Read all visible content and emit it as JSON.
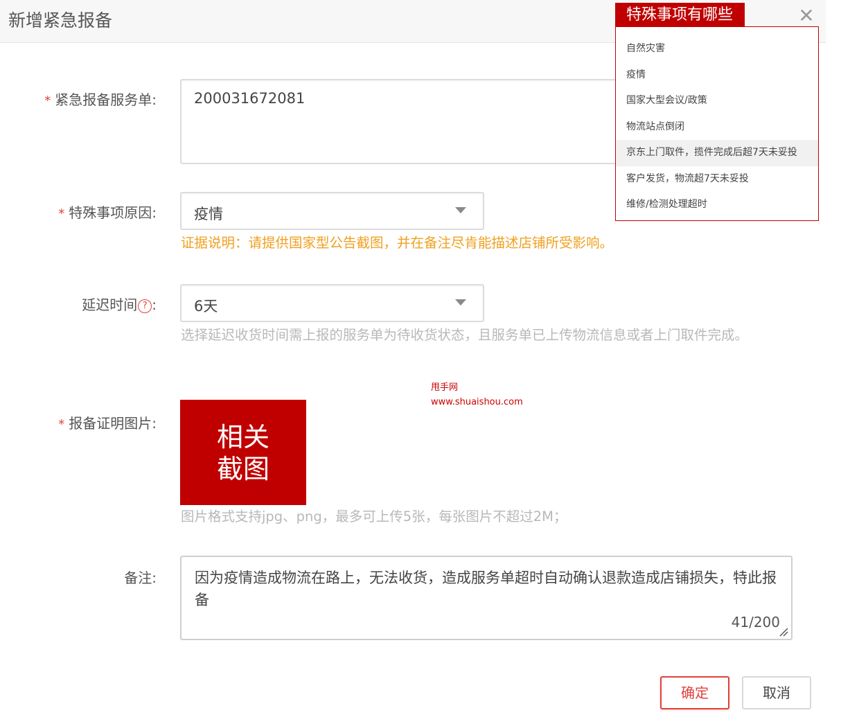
{
  "dialog": {
    "title": "新增紧急报备",
    "close_glyph": "✕"
  },
  "form": {
    "service_order": {
      "label": "紧急报备服务单:",
      "required_mark": "*",
      "value": "200031672081"
    },
    "special_reason": {
      "label": "特殊事项原因:",
      "required_mark": "*",
      "value": "疫情",
      "hint": "证据说明：请提供国家型公告截图，并在备注尽肯能描述店铺所受影响。"
    },
    "delay_time": {
      "label_main": "延迟时间",
      "label_colon": ":",
      "help_glyph": "?",
      "value": "6天",
      "hint": "选择延迟收货时间需上报的服务单为待收货状态，且服务单已上传物流信息或者上门取件完成。"
    },
    "proof_image": {
      "label": "报备证明图片:",
      "required_mark": "*",
      "placeholder_line1": "相关",
      "placeholder_line2": "截图",
      "hint": "图片格式支持jpg、png，最多可上传5张，每张图片不超过2M；"
    },
    "remark": {
      "label": "备注:",
      "value": "因为疫情造成物流在路上，无法收货，造成服务单超时自动确认退款造成店铺损失，特此报备",
      "counter": "41/200"
    }
  },
  "watermark": {
    "line1": "甩手网",
    "line2": "www.shuaishou.com"
  },
  "buttons": {
    "confirm": "确定",
    "cancel": "取消"
  },
  "popover": {
    "title": "特殊事项有哪些",
    "items": [
      {
        "label": "自然灾害"
      },
      {
        "label": "疫情"
      },
      {
        "label": "国家大型会议/政策"
      },
      {
        "label": "物流站点倒闭"
      },
      {
        "label": "京东上门取件，揽件完成后超7天未妥投"
      },
      {
        "label": "客户发货，物流超7天未妥投"
      },
      {
        "label": "维修/检测处理超时"
      }
    ]
  },
  "colors": {
    "accent": "#c00000",
    "required": "#e0403a",
    "hint_orange": "#f0a020",
    "hint_gray": "#b8b8b8"
  }
}
